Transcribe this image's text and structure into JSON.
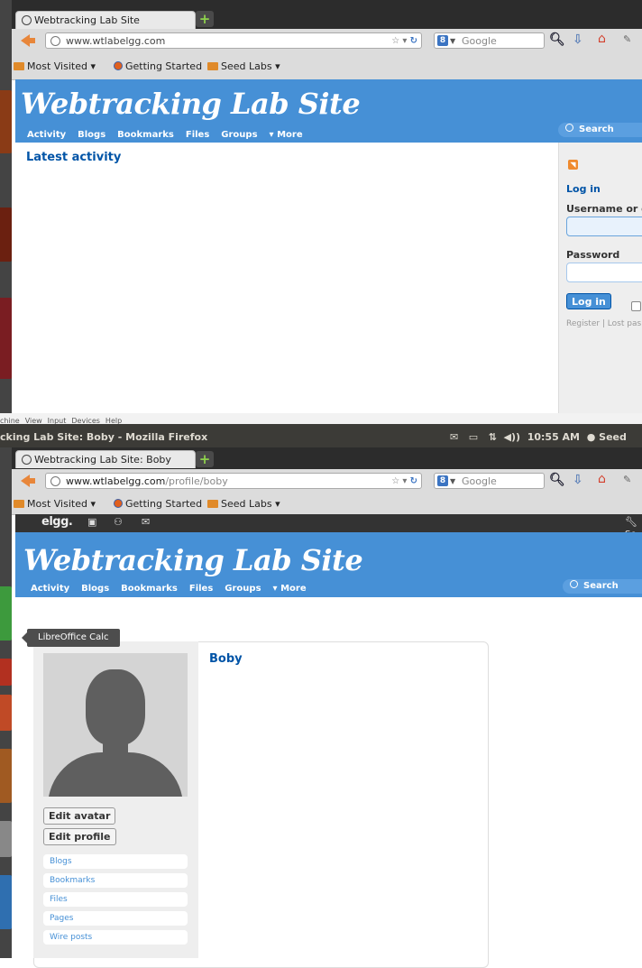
{
  "top_browser": {
    "tab_title": "Webtracking Lab Site",
    "url": "www.wtlabelgg.com",
    "search_placeholder": "Google",
    "search_engine_letter": "8",
    "bookmarks": [
      "Most Visited",
      "Getting Started",
      "Seed Labs"
    ]
  },
  "site": {
    "title": "Webtracking Lab Site",
    "nav": [
      "Activity",
      "Blogs",
      "Bookmarks",
      "Files",
      "Groups",
      "More"
    ],
    "search_label": "Search"
  },
  "activity_page": {
    "heading": "Latest activity",
    "login": {
      "title": "Log in",
      "username_label": "Username or em",
      "password_label": "Password",
      "button": "Log in",
      "links": "Register | Lost pas"
    }
  },
  "vm_menu": [
    "chine",
    "View",
    "Input",
    "Devices",
    "Help"
  ],
  "ubuntu_panel": {
    "window_title": "cking Lab Site: Boby - Mozilla Firefox",
    "time": "10:55 AM",
    "user": "Seed"
  },
  "bottom_browser": {
    "tab_title": "Webtracking Lab Site: Boby",
    "url_domain": "www.wtlabelgg.com",
    "url_path": "/profile/boby",
    "search_placeholder": "Google",
    "bookmarks": [
      "Most Visited",
      "Getting Started",
      "Seed Labs"
    ]
  },
  "elgg_topbar": {
    "logo": "elgg.",
    "settings_fragment": "Se"
  },
  "tooltip": "LibreOffice Calc",
  "profile": {
    "name": "Boby",
    "buttons": [
      "Edit avatar",
      "Edit profile"
    ],
    "owner_links": [
      "Blogs",
      "Bookmarks",
      "Files",
      "Pages",
      "Wire posts"
    ]
  },
  "colors": {
    "header_blue": "#4690d6",
    "link_dark_blue": "#0054a7",
    "panel_dark": "#3c3b37"
  }
}
